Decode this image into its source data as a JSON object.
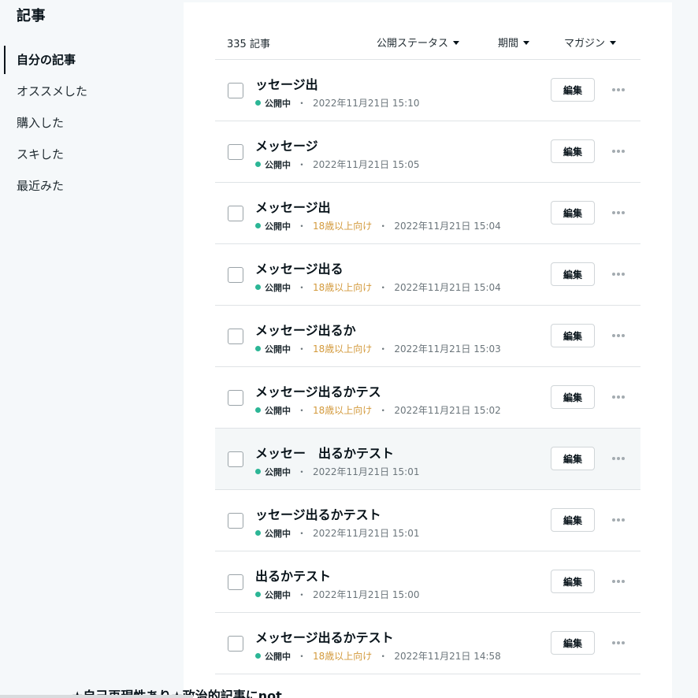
{
  "sidebar": {
    "title": "記事",
    "items": [
      {
        "label": "自分の記事",
        "active": true
      },
      {
        "label": "オススメした",
        "active": false
      },
      {
        "label": "購入した",
        "active": false
      },
      {
        "label": "スキした",
        "active": false
      },
      {
        "label": "最近みた",
        "active": false
      }
    ]
  },
  "header": {
    "count": "335 記事",
    "filter_status": "公開ステータス",
    "filter_period": "期間",
    "filter_magazine": "マガジン"
  },
  "colors": {
    "published_dot": "#2cb696",
    "age_restricted": "#d39a3c",
    "hover_row": "#f4f7f8"
  },
  "articles": [
    {
      "title": "ッセージ出",
      "status": "公開中",
      "age": "",
      "date": "2022年11月21日 15:10"
    },
    {
      "title": "メッセージ",
      "status": "公開中",
      "age": "",
      "date": "2022年11月21日 15:05"
    },
    {
      "title": "メッセージ出",
      "status": "公開中",
      "age": "18歳以上向け",
      "date": "2022年11月21日 15:04"
    },
    {
      "title": "メッセージ出る",
      "status": "公開中",
      "age": "18歳以上向け",
      "date": "2022年11月21日 15:04"
    },
    {
      "title": "メッセージ出るか",
      "status": "公開中",
      "age": "18歳以上向け",
      "date": "2022年11月21日 15:03"
    },
    {
      "title": "メッセージ出るかテス",
      "status": "公開中",
      "age": "18歳以上向け",
      "date": "2022年11月21日 15:02"
    },
    {
      "title": "メッセー　出るかテスト",
      "status": "公開中",
      "age": "",
      "date": "2022年11月21日 15:01"
    },
    {
      "title": "ッセージ出るかテスト",
      "status": "公開中",
      "age": "",
      "date": "2022年11月21日 15:01"
    },
    {
      "title": "出るかテスト",
      "status": "公開中",
      "age": "",
      "date": "2022年11月21日 15:00"
    },
    {
      "title": "メッセージ出るかテスト",
      "status": "公開中",
      "age": "18歳以上向け",
      "date": "2022年11月21日 14:58"
    }
  ],
  "edit_label": "編集",
  "partial_title": "★自己再現性あり★政治的記事にnot"
}
